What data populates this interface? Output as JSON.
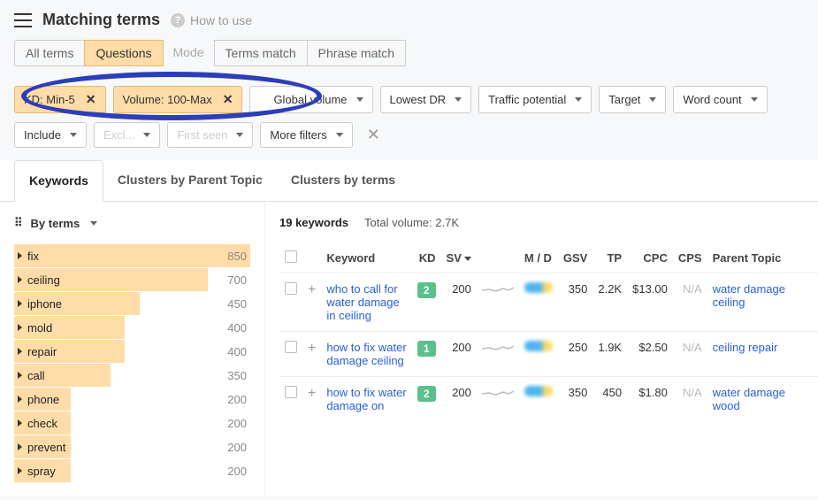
{
  "header": {
    "title": "Matching terms",
    "howto": "How to use"
  },
  "topTabs": {
    "all": "All terms",
    "questions": "Questions",
    "mode": "Mode",
    "termsMatch": "Terms match",
    "phraseMatch": "Phrase match"
  },
  "filters": {
    "kd": "KD: Min-5",
    "volume": "Volume: 100-Max",
    "globalVolume": "Global volume",
    "lowestDr": "Lowest DR",
    "trafficPotential": "Traffic potential",
    "target": "Target",
    "wordCount": "Word count",
    "include": "Include",
    "hidden1": "Excl...",
    "hidden2": "First seen",
    "moreFilters": "More filters"
  },
  "resultTabs": {
    "keywords": "Keywords",
    "clustersParent": "Clusters by Parent Topic",
    "clustersTerms": "Clusters by terms"
  },
  "sidebar": {
    "byTerms": "By terms",
    "terms": [
      {
        "label": "fix",
        "count": 850,
        "pct": 100
      },
      {
        "label": "ceiling",
        "count": 700,
        "pct": 82
      },
      {
        "label": "iphone",
        "count": 450,
        "pct": 53
      },
      {
        "label": "mold",
        "count": 400,
        "pct": 47
      },
      {
        "label": "repair",
        "count": 400,
        "pct": 47
      },
      {
        "label": "call",
        "count": 350,
        "pct": 41
      },
      {
        "label": "phone",
        "count": 200,
        "pct": 24
      },
      {
        "label": "check",
        "count": 200,
        "pct": 24
      },
      {
        "label": "prevent",
        "count": 200,
        "pct": 24
      },
      {
        "label": "spray",
        "count": 200,
        "pct": 24
      }
    ]
  },
  "summary": {
    "countLabel": "19 keywords",
    "volumeLabel": "Total volume: 2.7K"
  },
  "columns": {
    "keyword": "Keyword",
    "kd": "KD",
    "sv": "SV",
    "md": "M / D",
    "gsv": "GSV",
    "tp": "TP",
    "cpc": "CPC",
    "cps": "CPS",
    "parent": "Parent Topic"
  },
  "rows": [
    {
      "keyword": "who to call for water damage in ceiling",
      "kd": "2",
      "sv": "200",
      "gsv": "350",
      "tp": "2.2K",
      "cpc": "$13.00",
      "cps": "N/A",
      "parent": "water damage ceiling"
    },
    {
      "keyword": "how to fix water damage ceiling",
      "kd": "1",
      "sv": "200",
      "gsv": "250",
      "tp": "1.9K",
      "cpc": "$2.50",
      "cps": "N/A",
      "parent": "ceiling repair"
    },
    {
      "keyword": "how to fix water damage on",
      "kd": "2",
      "sv": "200",
      "gsv": "350",
      "tp": "450",
      "cpc": "$1.80",
      "cps": "N/A",
      "parent": "water damage wood"
    }
  ]
}
